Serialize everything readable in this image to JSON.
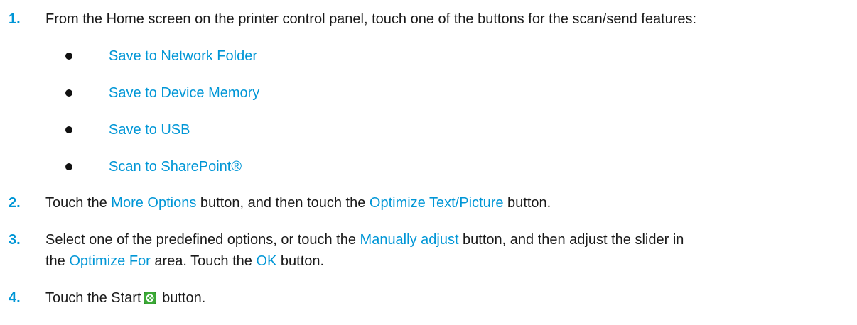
{
  "steps": [
    {
      "number": "1.",
      "text": "From the Home screen on the printer control panel, touch one of the buttons for the scan/send features:",
      "bullets": [
        "Save to Network Folder",
        "Save to Device Memory",
        "Save to USB",
        "Scan to SharePoint®"
      ]
    },
    {
      "number": "2.",
      "t1": "Touch the ",
      "l1": "More Options",
      "t2": " button, and then touch the ",
      "l2": "Optimize Text/Picture",
      "t3": " button."
    },
    {
      "number": "3.",
      "t1": "Select one of the predefined options, or touch the ",
      "l1": "Manually adjust",
      "t2": " button, and then adjust the slider in",
      "t3": "the ",
      "l2": "Optimize For",
      "t4": " area. Touch the ",
      "l3": "OK",
      "t5": " button."
    },
    {
      "number": "4.",
      "t1": "Touch the Start",
      "icon": "start-button-icon",
      "t2": " button."
    }
  ],
  "colors": {
    "link": "#0096d6",
    "start_icon": "#3aa835"
  }
}
